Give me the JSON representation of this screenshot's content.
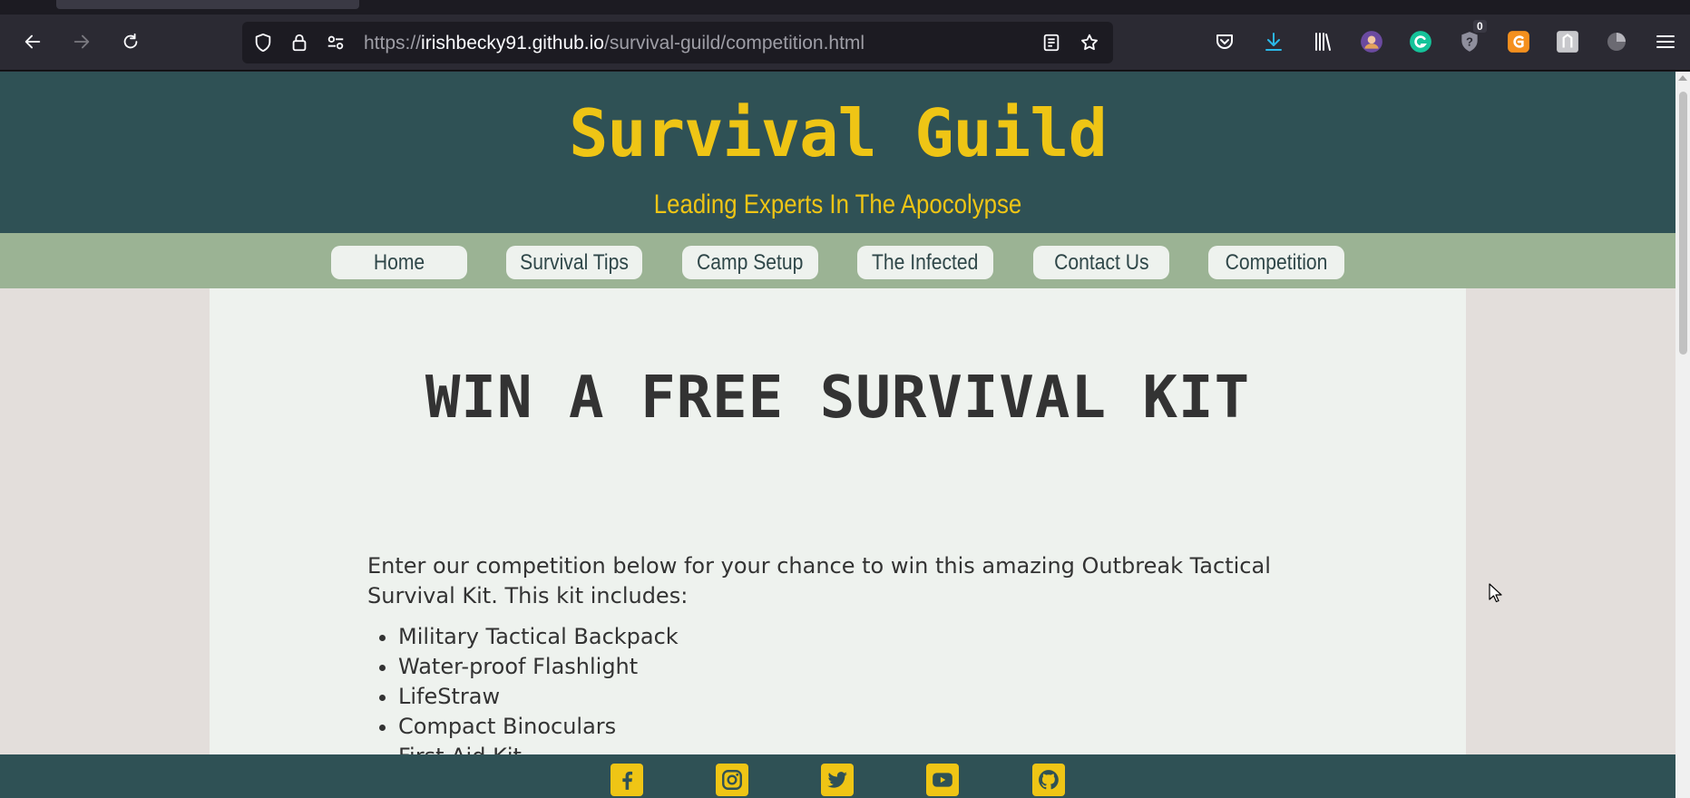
{
  "browser": {
    "url_scheme": "https://",
    "url_host": "irishbecky91.github.io",
    "url_path": "/survival-guild/competition.html",
    "notification_badge": "0",
    "icons": [
      "back-icon",
      "forward-icon",
      "reload-icon",
      "shield-icon",
      "lock-icon",
      "permissions-icon",
      "reader-view-icon",
      "bookmark-star-icon",
      "pocket-icon",
      "download-icon",
      "library-icon",
      "extension-avatar-icon",
      "grammarly-icon",
      "password-manager-icon",
      "extension-orange-icon",
      "extension-gray-icon",
      "extension-pie-icon",
      "menu-icon"
    ]
  },
  "site": {
    "title": "Survival Guild",
    "subtitle": "Leading Experts In The Apocolypse",
    "nav": [
      "Home",
      "Survival Tips",
      "Camp Setup",
      "The Infected",
      "Contact Us",
      "Competition"
    ]
  },
  "main": {
    "headline": "WIN A FREE SURVIVAL KIT",
    "intro": "Enter our competition below for your chance to win this amazing Outbreak Tactical Survival Kit. This kit includes:",
    "kit_items": [
      "Military Tactical Backpack",
      "Water-proof Flashlight",
      "LifeStraw",
      "Compact Binoculars",
      "First Aid Kit"
    ]
  },
  "footer": {
    "social_icons": [
      "facebook-icon",
      "instagram-icon",
      "twitter-icon",
      "youtube-icon",
      "github-icon"
    ]
  },
  "colors": {
    "header_bg": "#2f5155",
    "accent_yellow": "#efc515",
    "nav_bg": "#9bb394",
    "content_bg": "#eef2ee",
    "side_bg": "#e3dedb",
    "text": "#333333"
  }
}
